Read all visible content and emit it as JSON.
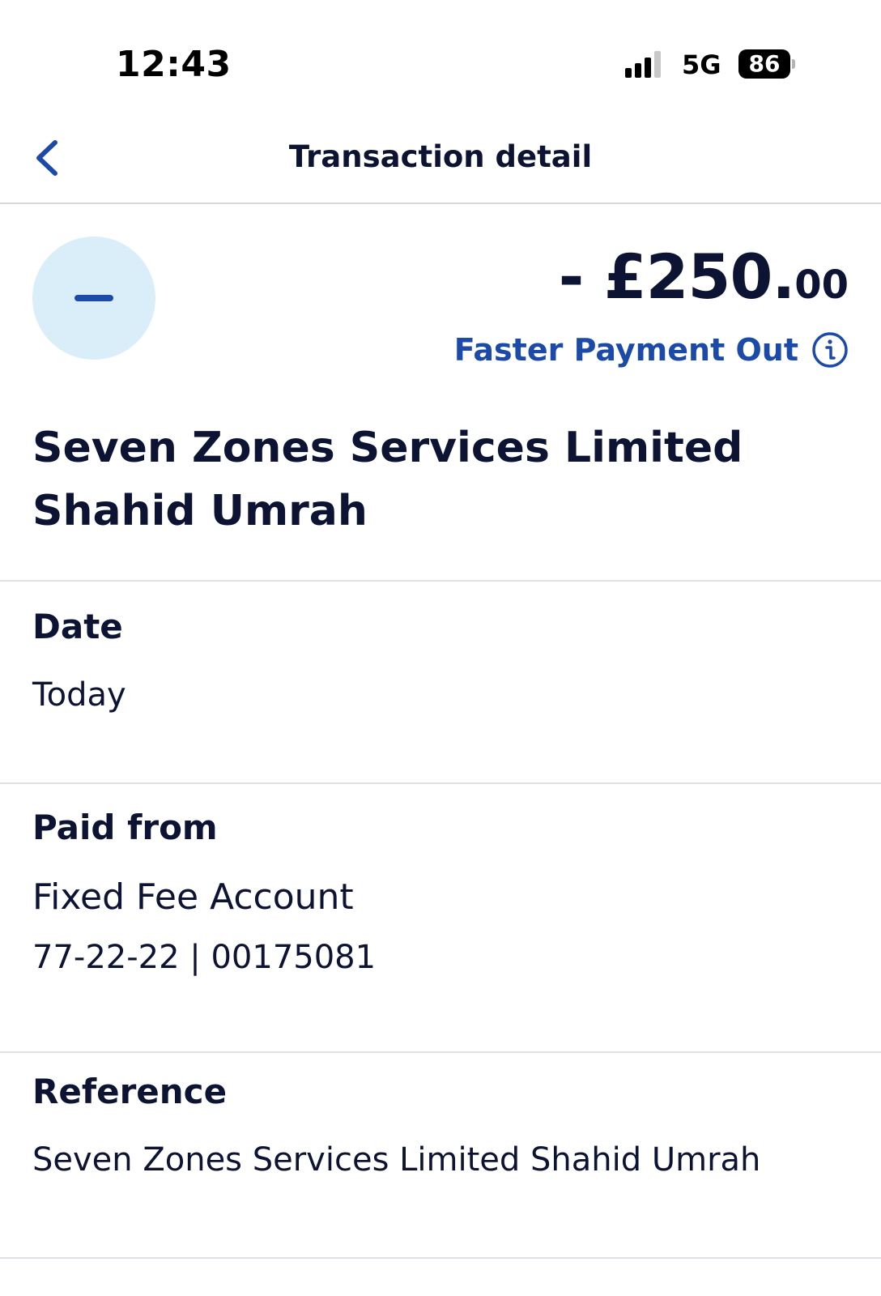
{
  "status_bar": {
    "time": "12:43",
    "network": "5G",
    "battery_level": "86",
    "signal_icon": "cellular-signal-icon"
  },
  "header": {
    "title": "Transaction detail",
    "back_icon": "chevron-left-icon"
  },
  "transaction": {
    "icon": "minus-icon",
    "amount_main": "- £250.",
    "amount_minor": "00",
    "payment_type": "Faster Payment Out",
    "payment_type_icon": "info-icon",
    "payee_line1": "Seven Zones Services Limited",
    "payee_line2": "Shahid Umrah"
  },
  "details": {
    "date": {
      "label": "Date",
      "value": "Today"
    },
    "paid_from": {
      "label": "Paid from",
      "account_name": "Fixed Fee Account",
      "account_number": "77-22-22 | 00175081"
    },
    "reference": {
      "label": "Reference",
      "value": "Seven Zones Services Limited Shahid Umrah"
    }
  },
  "colors": {
    "brand_blue": "#1b4aa8",
    "text_dark": "#0d1433",
    "icon_circle_bg": "#d9eef8",
    "divider": "#dfe1e6"
  }
}
